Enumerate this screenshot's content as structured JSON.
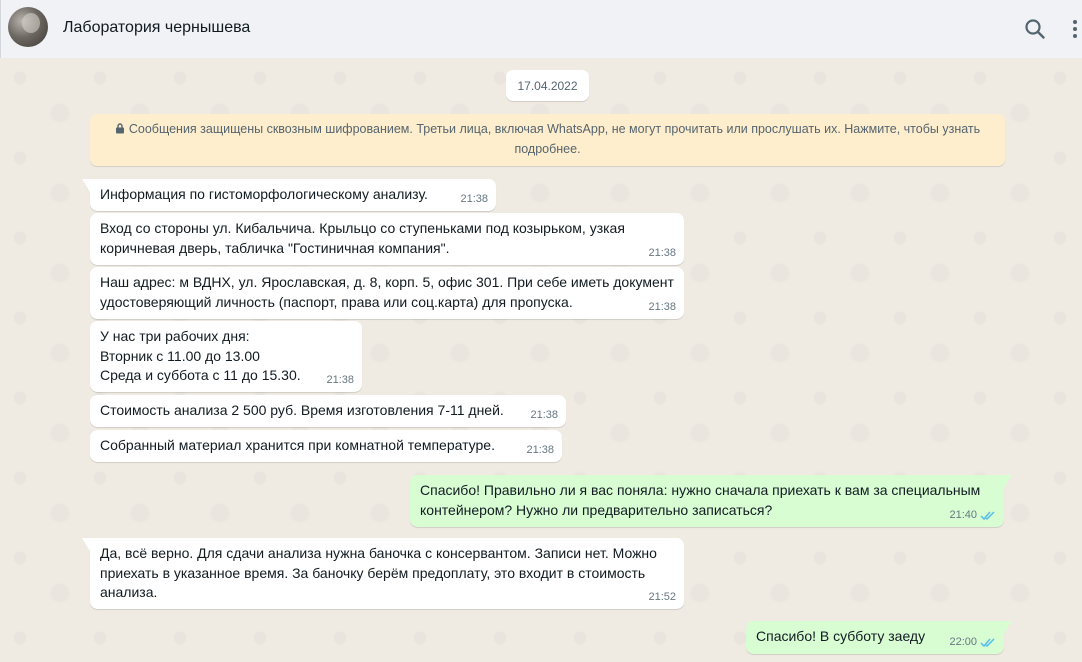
{
  "header": {
    "title": "Лаборатория чернышева",
    "icons": {
      "search": "search-icon",
      "menu": "menu-icon"
    }
  },
  "date_chip": "17.04.2022",
  "encryption_notice": "Сообщения защищены сквозным шифрованием. Третьи лица, включая WhatsApp, не могут прочитать или прослушать их. Нажмите, чтобы узнать подробнее.",
  "colors": {
    "incoming_bubble": "#ffffff",
    "outgoing_bubble": "#d9fdd3",
    "chat_background": "#efeae2",
    "notice_background": "#ffeecd",
    "read_ticks": "#53bdeb"
  },
  "messages": [
    {
      "dir": "in",
      "text": "Информация по гистоморфологическому анализу.",
      "time": "21:38"
    },
    {
      "dir": "in",
      "text": "Вход со стороны ул. Кибальчича. Крыльцо со ступеньками под козырьком, узкая\nкоричневая дверь, табличка \"Гостиничная компания\".",
      "time": "21:38"
    },
    {
      "dir": "in",
      "text": "Наш адрес: м ВДНХ, ул. Ярославская, д. 8, корп. 5, офис 301. При себе иметь документ\nудостоверяющий личность (паспорт, права или соц.карта) для пропуска.",
      "time": "21:38"
    },
    {
      "dir": "in",
      "text": "У нас три рабочих дня:\nВторник с 11.00 до 13.00\nСреда и суббота с 11 до 15.30.",
      "time": "21:38"
    },
    {
      "dir": "in",
      "text": "Стоимость анализа 2 500 руб. Время изготовления 7-11 дней.",
      "time": "21:38"
    },
    {
      "dir": "in",
      "text": "Собранный материал хранится при комнатной температуре.",
      "time": "21:38"
    },
    {
      "dir": "out",
      "text": "Спасибо! Правильно ли я вас поняла: нужно сначала приехать к вам за специальным\nконтейнером? Нужно ли предварительно записаться?",
      "time": "21:40",
      "status": "read"
    },
    {
      "dir": "in",
      "text": "Да, всё верно. Для сдачи анализа нужна баночка с консервантом. Записи нет. Можно\nприехать в указанное время. За баночку берём предоплату, это входит в стоимость\nанализа.",
      "time": "21:52"
    },
    {
      "dir": "out",
      "text": "Спасибо! В субботу заеду",
      "time": "22:00",
      "status": "read"
    }
  ]
}
